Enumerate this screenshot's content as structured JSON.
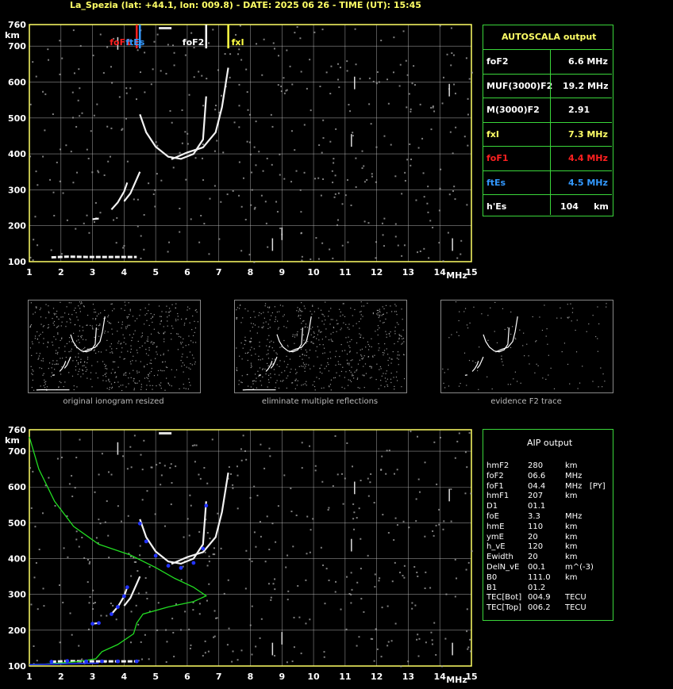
{
  "header": {
    "title": "La_Spezia (lat: +44.1, lon: 009.8) - DATE: 2025 06 26 - TIME (UT): 15:45"
  },
  "axes": {
    "y_unit": "km",
    "x_unit": "MHz",
    "y_ticks": [
      "760",
      "700",
      "600",
      "500",
      "400",
      "300",
      "200",
      "100"
    ],
    "x_ticks": [
      "1",
      "2",
      "3",
      "4",
      "5",
      "6",
      "7",
      "8",
      "9",
      "10",
      "11",
      "12",
      "13",
      "14",
      "15"
    ]
  },
  "markers": {
    "foF1_label": "foF1",
    "ftEs_label": "ftEs",
    "foF2_label": "foF2",
    "fxI_label": "fxI"
  },
  "colors": {
    "grid": "#c8c8c8",
    "axis": "#ffff66",
    "panel_border": "#3ad63a",
    "foF1": "#ff2020",
    "ftEs": "#3399ff",
    "fxI": "#ffff44",
    "profile": "#22dd22",
    "aip_trace": "#2233ff"
  },
  "autoscala": {
    "title": "AUTOSCALA output",
    "rows": [
      {
        "label": "foF2",
        "value": "6.6 MHz",
        "color": "#ffffff"
      },
      {
        "label": "MUF(3000)F2",
        "value": "19.2 MHz",
        "color": "#ffffff"
      },
      {
        "label": "M(3000)F2",
        "value": "2.91",
        "color": "#ffffff"
      },
      {
        "label": "fxI",
        "value": "7.3 MHz",
        "color": "#ffff66"
      },
      {
        "label": "foF1",
        "value": "4.4 MHz",
        "color": "#ff2020"
      },
      {
        "label": "ftEs",
        "value": "4.5 MHz",
        "color": "#3399ff"
      },
      {
        "label": "h'Es",
        "value": "104     km",
        "color": "#ffffff"
      }
    ]
  },
  "thumbnails": [
    {
      "caption": "original ionogram resized"
    },
    {
      "caption": "eliminate multiple reflections"
    },
    {
      "caption": "evidence F2 trace"
    }
  ],
  "aip": {
    "title": "AIP output",
    "rows": [
      {
        "k": "hmF2",
        "v": "280",
        "u": "km"
      },
      {
        "k": "foF2",
        "v": "06.6",
        "u": "MHz"
      },
      {
        "k": "foF1",
        "v": "04.4",
        "u": "MHz   [PY]"
      },
      {
        "k": "hmF1",
        "v": "207",
        "u": "km"
      },
      {
        "k": "D1",
        "v": "01.1",
        "u": ""
      },
      {
        "k": "foE",
        "v": "3.3",
        "u": "MHz"
      },
      {
        "k": "hmE",
        "v": "110",
        "u": "km"
      },
      {
        "k": "ymE",
        "v": "20",
        "u": "km"
      },
      {
        "k": "h_vE",
        "v": "120",
        "u": "km"
      },
      {
        "k": "Ewidth",
        "v": "20",
        "u": "km"
      },
      {
        "k": "DelN_vE",
        "v": "00.1",
        "u": "m^(-3)"
      },
      {
        "k": "B0",
        "v": "111.0",
        "u": "km"
      },
      {
        "k": "B1",
        "v": "01.2",
        "u": ""
      },
      {
        "k": "TEC[Bot]",
        "v": "004.9",
        "u": "TECU"
      },
      {
        "k": "TEC[Top]",
        "v": "006.2",
        "u": "TECU"
      }
    ]
  },
  "chart_data": [
    {
      "type": "scatter",
      "name": "scaled ionogram",
      "xlabel": "MHz",
      "ylabel": "km",
      "xlim": [
        1,
        15
      ],
      "ylim": [
        100,
        760
      ],
      "grid": true,
      "vertical_markers": [
        {
          "label": "foF1",
          "x": 4.4
        },
        {
          "label": "ftEs",
          "x": 4.5
        },
        {
          "label": "foF2",
          "x": 6.6
        },
        {
          "label": "fxI",
          "x": 7.3
        }
      ],
      "traces": {
        "Es": [
          [
            1.7,
            112
          ],
          [
            2.2,
            114
          ],
          [
            2.8,
            113
          ],
          [
            3.3,
            113
          ],
          [
            3.8,
            113
          ],
          [
            4.4,
            113
          ]
        ],
        "E_small": [
          [
            3.0,
            218
          ],
          [
            3.2,
            220
          ]
        ],
        "F1_o": [
          [
            3.6,
            245
          ],
          [
            3.8,
            265
          ],
          [
            4.0,
            295
          ],
          [
            4.1,
            320
          ]
        ],
        "F1_x": [
          [
            4.0,
            268
          ],
          [
            4.2,
            290
          ],
          [
            4.4,
            330
          ],
          [
            4.5,
            350
          ]
        ],
        "F2_o": [
          [
            4.5,
            510
          ],
          [
            4.7,
            460
          ],
          [
            5.0,
            420
          ],
          [
            5.4,
            392
          ],
          [
            5.8,
            386
          ],
          [
            6.2,
            400
          ],
          [
            6.5,
            440
          ],
          [
            6.6,
            560
          ]
        ],
        "F2_x": [
          [
            5.5,
            385
          ],
          [
            6.0,
            404
          ],
          [
            6.5,
            418
          ],
          [
            6.9,
            460
          ],
          [
            7.1,
            530
          ],
          [
            7.3,
            640
          ]
        ]
      }
    },
    {
      "type": "line",
      "name": "AIP profile",
      "xlabel": "MHz",
      "ylabel": "km",
      "xlim": [
        1,
        15
      ],
      "ylim": [
        100,
        760
      ],
      "grid": true,
      "profile": [
        [
          1.0,
          740
        ],
        [
          1.3,
          650
        ],
        [
          1.8,
          560
        ],
        [
          2.4,
          490
        ],
        [
          3.2,
          440
        ],
        [
          4.2,
          410
        ],
        [
          5.0,
          375
        ],
        [
          5.6,
          345
        ],
        [
          6.2,
          320
        ],
        [
          6.6,
          296
        ],
        [
          6.2,
          280
        ],
        [
          5.4,
          265
        ],
        [
          4.6,
          245
        ],
        [
          4.4,
          220
        ],
        [
          4.3,
          190
        ],
        [
          3.8,
          160
        ],
        [
          3.3,
          140
        ],
        [
          3.1,
          120
        ],
        [
          2.5,
          112
        ],
        [
          1.5,
          105
        ],
        [
          1.0,
          104
        ]
      ]
    }
  ]
}
